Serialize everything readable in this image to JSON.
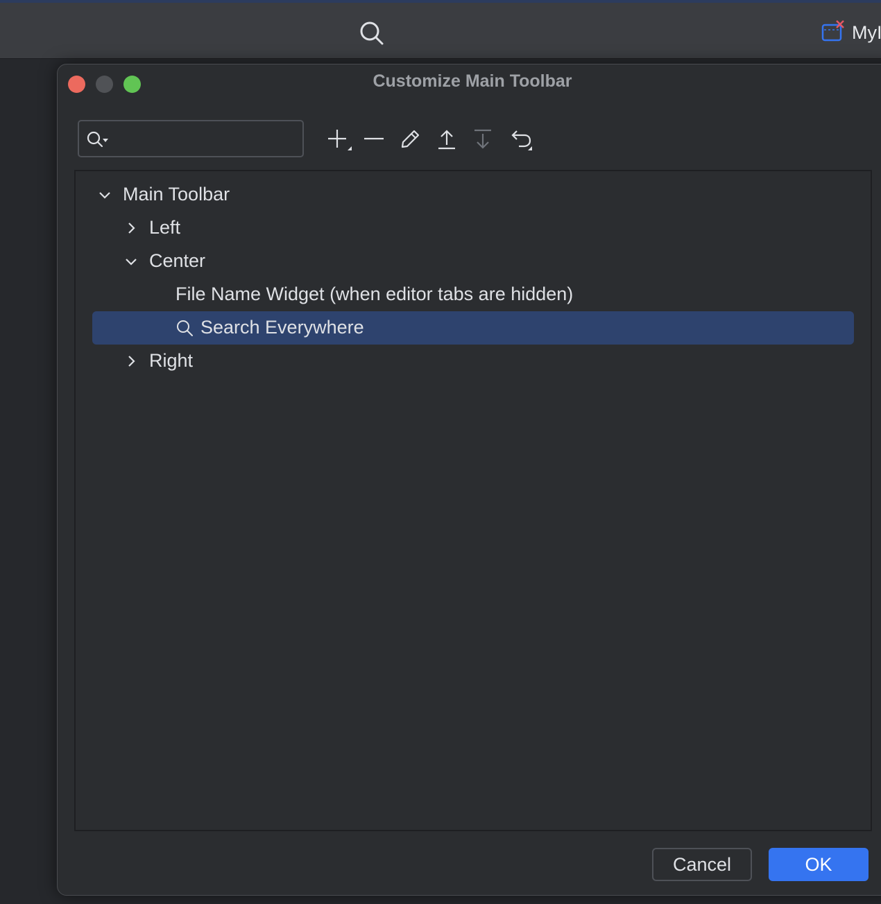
{
  "ide": {
    "project_label": "MyI",
    "search_icon": "search-icon",
    "project_icon": "window-close-icon"
  },
  "dialog": {
    "title": "Customize Main Toolbar",
    "filter": {
      "value": "",
      "placeholder": ""
    },
    "toolbar": [
      {
        "name": "add-button",
        "icon": "plus-icon",
        "enabled": true
      },
      {
        "name": "remove-button",
        "icon": "minus-icon",
        "enabled": true
      },
      {
        "name": "edit-button",
        "icon": "pencil-icon",
        "enabled": true
      },
      {
        "name": "move-up-button",
        "icon": "arrow-up-icon",
        "enabled": true
      },
      {
        "name": "move-down-button",
        "icon": "arrow-down-icon",
        "enabled": false
      },
      {
        "name": "restore-button",
        "icon": "undo-icon",
        "enabled": true
      }
    ],
    "tree": {
      "root": {
        "label": "Main Toolbar",
        "expanded": true
      },
      "left": {
        "label": "Left",
        "expanded": false
      },
      "center": {
        "label": "Center",
        "expanded": true
      },
      "file_name_widget": {
        "label": "File Name Widget (when editor tabs are hidden)"
      },
      "search_everywhere": {
        "label": "Search Everywhere",
        "selected": true,
        "icon": "search-icon"
      },
      "right": {
        "label": "Right",
        "expanded": false
      }
    },
    "buttons": {
      "cancel": "Cancel",
      "ok": "OK"
    }
  },
  "colors": {
    "accent": "#3574f0",
    "selection": "#2e436e",
    "dialog_bg": "#2b2d30",
    "close": "#ec6a5e",
    "zoom": "#61c454"
  }
}
